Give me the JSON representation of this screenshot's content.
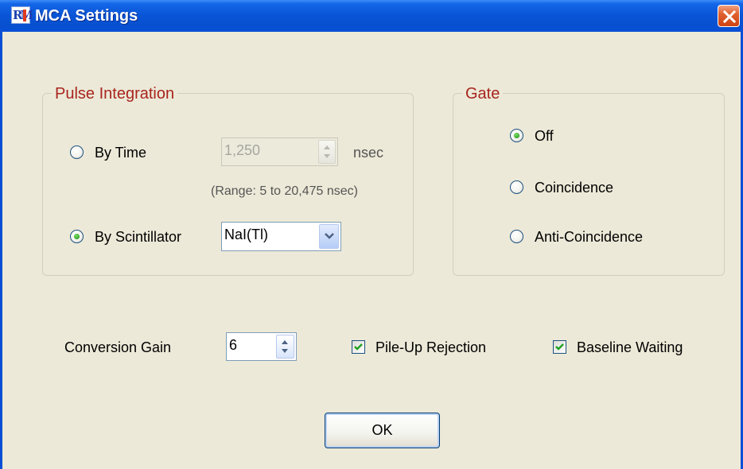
{
  "window": {
    "title": "MCA Settings",
    "app_icon": "rm-app-icon"
  },
  "pulse_integration": {
    "title": "Pulse Integration",
    "by_time_label": "By Time",
    "by_time_selected": false,
    "time_value": "1,250",
    "time_unit": "nsec",
    "range_hint": "(Range: 5 to 20,475 nsec)",
    "by_scintillator_label": "By Scintillator",
    "by_scintillator_selected": true,
    "scintillator_value": "NaI(Tl)"
  },
  "gate": {
    "title": "Gate",
    "options": [
      {
        "label": "Off",
        "selected": true
      },
      {
        "label": "Coincidence",
        "selected": false
      },
      {
        "label": "Anti-Coincidence",
        "selected": false
      }
    ]
  },
  "conversion_gain": {
    "label": "Conversion Gain",
    "value": "6"
  },
  "pile_up_rejection": {
    "label": "Pile-Up Rejection",
    "checked": true
  },
  "baseline_waiting": {
    "label": "Baseline Waiting",
    "checked": true
  },
  "ok_button": {
    "label": "OK"
  },
  "colors": {
    "titlebar": "#0a56d8",
    "dialog_bg": "#ece9d8",
    "group_title": "#a8251e",
    "close_button": "#e0612f"
  }
}
